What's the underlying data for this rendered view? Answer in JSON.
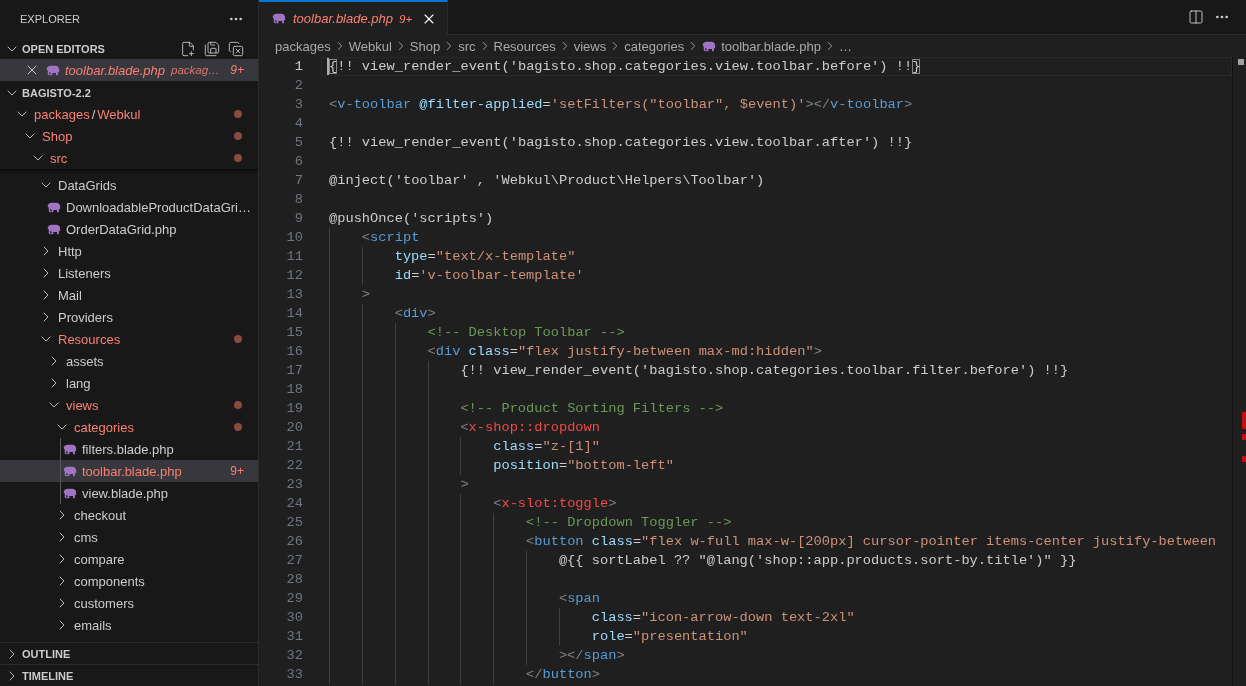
{
  "sidebar": {
    "title": "EXPLORER",
    "open_editors": {
      "title": "OPEN EDITORS",
      "expanded": true,
      "items": [
        {
          "name": "toolbar.blade.php",
          "path": "packag…",
          "badge": "9+",
          "error": true,
          "preview": true,
          "selected": true
        }
      ]
    },
    "project": {
      "title": "BAGISTO-2.2",
      "expanded": true,
      "tree": [
        {
          "kind": "folder",
          "segments": [
            "packages",
            "Webkul"
          ],
          "separator": "/",
          "expanded": true,
          "error": true,
          "selected": false,
          "children": [
            {
              "kind": "folder",
              "name": "Shop",
              "expanded": true,
              "error": true,
              "selected": false,
              "children": [
                {
                  "kind": "folder",
                  "name": "src",
                  "expanded": true,
                  "error": true,
                  "sticky": true,
                  "selected": false,
                  "children": [
                    {
                      "kind": "folder",
                      "name": "DataGrids",
                      "expanded": true,
                      "error": false,
                      "selected": false,
                      "children": [
                        {
                          "kind": "file",
                          "name": "DownloadableProductDataGri…",
                          "error": false,
                          "selected": false
                        },
                        {
                          "kind": "file",
                          "name": "OrderDataGrid.php",
                          "error": false,
                          "selected": false
                        }
                      ]
                    },
                    {
                      "kind": "folder",
                      "name": "Http",
                      "expanded": false,
                      "error": false,
                      "selected": false
                    },
                    {
                      "kind": "folder",
                      "name": "Listeners",
                      "expanded": false,
                      "error": false,
                      "selected": false
                    },
                    {
                      "kind": "folder",
                      "name": "Mail",
                      "expanded": false,
                      "error": false,
                      "selected": false
                    },
                    {
                      "kind": "folder",
                      "name": "Providers",
                      "expanded": false,
                      "error": false,
                      "selected": false
                    },
                    {
                      "kind": "folder",
                      "name": "Resources",
                      "expanded": true,
                      "error": true,
                      "selected": false,
                      "children": [
                        {
                          "kind": "folder",
                          "name": "assets",
                          "expanded": false,
                          "error": false,
                          "selected": false
                        },
                        {
                          "kind": "folder",
                          "name": "lang",
                          "expanded": false,
                          "error": false,
                          "selected": false
                        },
                        {
                          "kind": "folder",
                          "name": "views",
                          "expanded": true,
                          "error": true,
                          "selected": false,
                          "children": [
                            {
                              "kind": "folder",
                              "name": "categories",
                              "expanded": true,
                              "error": true,
                              "selected": false,
                              "children": [
                                {
                                  "kind": "file",
                                  "name": "filters.blade.php",
                                  "error": false,
                                  "selected": false
                                },
                                {
                                  "kind": "file",
                                  "name": "toolbar.blade.php",
                                  "badge": "9+",
                                  "error": true,
                                  "selected": true
                                },
                                {
                                  "kind": "file",
                                  "name": "view.blade.php",
                                  "error": false,
                                  "selected": false
                                }
                              ]
                            },
                            {
                              "kind": "folder",
                              "name": "checkout",
                              "expanded": false,
                              "error": false,
                              "selected": false
                            },
                            {
                              "kind": "folder",
                              "name": "cms",
                              "expanded": false,
                              "error": false,
                              "selected": false
                            },
                            {
                              "kind": "folder",
                              "name": "compare",
                              "expanded": false,
                              "error": false,
                              "selected": false
                            },
                            {
                              "kind": "folder",
                              "name": "components",
                              "expanded": false,
                              "error": false,
                              "selected": false
                            },
                            {
                              "kind": "folder",
                              "name": "customers",
                              "expanded": false,
                              "error": false,
                              "selected": false
                            },
                            {
                              "kind": "folder",
                              "name": "emails",
                              "expanded": false,
                              "error": false,
                              "selected": false
                            }
                          ]
                        }
                      ]
                    }
                  ]
                }
              ]
            }
          ]
        }
      ]
    },
    "sections": [
      {
        "title": "OUTLINE",
        "expanded": false
      },
      {
        "title": "TIMELINE",
        "expanded": false
      }
    ]
  },
  "editor": {
    "tabs": [
      {
        "label": "toolbar.blade.php",
        "badge": "9+",
        "error": true,
        "preview": true,
        "selected": true
      }
    ],
    "breadcrumbs": [
      {
        "kind": "folder",
        "text": "packages"
      },
      {
        "kind": "folder",
        "text": "Webkul"
      },
      {
        "kind": "folder",
        "text": "Shop"
      },
      {
        "kind": "folder",
        "text": "src"
      },
      {
        "kind": "folder",
        "text": "Resources"
      },
      {
        "kind": "folder",
        "text": "views"
      },
      {
        "kind": "folder",
        "text": "categories"
      },
      {
        "kind": "file",
        "text": "toolbar.blade.php"
      },
      {
        "kind": "more",
        "text": "…"
      }
    ],
    "code": {
      "lines": [
        {
          "number": "1",
          "active": true,
          "tokens": [
            {
              "kind": "bracket",
              "text": "{"
            },
            {
              "kind": "plain",
              "text": "!! view_render_event('bagisto.shop.categories.view.toolbar.before') !!"
            },
            {
              "kind": "bracket",
              "text": "}"
            }
          ]
        },
        {
          "number": "2",
          "active": false
        },
        {
          "number": "3",
          "active": false,
          "tokens": [
            {
              "kind": "punct",
              "text": "<"
            },
            {
              "kind": "tag",
              "text": "v-toolbar"
            },
            {
              "kind": "attr",
              "text": " @filter-applied"
            },
            {
              "kind": "plain",
              "text": "="
            },
            {
              "kind": "string",
              "text": "'setFilters(\"toolbar\", $event)'"
            },
            {
              "kind": "punct",
              "text": "></"
            },
            {
              "kind": "tag",
              "text": "v-toolbar"
            },
            {
              "kind": "punct",
              "text": ">"
            }
          ]
        },
        {
          "number": "4",
          "active": false
        },
        {
          "number": "5",
          "active": false,
          "tokens": [
            {
              "kind": "plain",
              "text": "{!! view_render_event('bagisto.shop.categories.view.toolbar.after') !!}"
            }
          ]
        },
        {
          "number": "6",
          "active": false
        },
        {
          "number": "7",
          "active": false,
          "tokens": [
            {
              "kind": "plain",
              "text": "@inject('toolbar' , 'Webkul\\Product\\Helpers\\Toolbar')"
            }
          ]
        },
        {
          "number": "8",
          "active": false
        },
        {
          "number": "9",
          "active": false,
          "tokens": [
            {
              "kind": "plain",
              "text": "@pushOnce('scripts')"
            }
          ],
          "children": [
            {
              "number": "10",
              "active": false,
              "tokens": [
                {
                  "kind": "punct",
                  "text": "<"
                },
                {
                  "kind": "tag",
                  "text": "script"
                }
              ],
              "children": [
                {
                  "number": "11",
                  "active": false,
                  "tokens": [
                    {
                      "kind": "attr",
                      "text": "type"
                    },
                    {
                      "kind": "plain",
                      "text": "="
                    },
                    {
                      "kind": "string",
                      "text": "\"text/x-template\""
                    }
                  ]
                },
                {
                  "number": "12",
                  "active": false,
                  "tokens": [
                    {
                      "kind": "attr",
                      "text": "id"
                    },
                    {
                      "kind": "plain",
                      "text": "="
                    },
                    {
                      "kind": "string",
                      "text": "'v-toolbar-template'"
                    }
                  ]
                }
              ]
            },
            {
              "number": "13",
              "active": false,
              "tokens": [
                {
                  "kind": "punct",
                  "text": ">"
                }
              ],
              "children": [
                {
                  "number": "14",
                  "active": false,
                  "tokens": [
                    {
                      "kind": "punct",
                      "text": "<"
                    },
                    {
                      "kind": "tag",
                      "text": "div"
                    },
                    {
                      "kind": "punct",
                      "text": ">"
                    }
                  ],
                  "children": [
                    {
                      "number": "15",
                      "active": false,
                      "tokens": [
                        {
                          "kind": "comment",
                          "text": "<!-- Desktop Toolbar -->"
                        }
                      ]
                    },
                    {
                      "number": "16",
                      "active": false,
                      "tokens": [
                        {
                          "kind": "punct",
                          "text": "<"
                        },
                        {
                          "kind": "tag",
                          "text": "div"
                        },
                        {
                          "kind": "attr",
                          "text": " class"
                        },
                        {
                          "kind": "plain",
                          "text": "="
                        },
                        {
                          "kind": "string",
                          "text": "\"flex justify-between max-md:hidden\""
                        },
                        {
                          "kind": "punct",
                          "text": ">"
                        }
                      ],
                      "children": [
                        {
                          "number": "17",
                          "active": false,
                          "tokens": [
                            {
                              "kind": "plain",
                              "text": "{!! view_render_event('bagisto.shop.categories.toolbar.filter.before') !!}"
                            }
                          ]
                        },
                        {
                          "number": "18",
                          "active": false
                        },
                        {
                          "number": "19",
                          "active": false,
                          "tokens": [
                            {
                              "kind": "comment",
                              "text": "<!-- Product Sorting Filters -->"
                            }
                          ]
                        },
                        {
                          "number": "20",
                          "active": false,
                          "tokens": [
                            {
                              "kind": "punct",
                              "text": "<"
                            },
                            {
                              "kind": "component",
                              "text": "x-shop::dropdown"
                            }
                          ],
                          "children": [
                            {
                              "number": "21",
                              "active": false,
                              "tokens": [
                                {
                                  "kind": "attr",
                                  "text": "class"
                                },
                                {
                                  "kind": "plain",
                                  "text": "="
                                },
                                {
                                  "kind": "string",
                                  "text": "\"z-[1]\""
                                }
                              ]
                            },
                            {
                              "number": "22",
                              "active": false,
                              "tokens": [
                                {
                                  "kind": "attr",
                                  "text": "position"
                                },
                                {
                                  "kind": "plain",
                                  "text": "="
                                },
                                {
                                  "kind": "string",
                                  "text": "\"bottom-left\""
                                }
                              ]
                            }
                          ]
                        },
                        {
                          "number": "23",
                          "active": false,
                          "tokens": [
                            {
                              "kind": "punct",
                              "text": ">"
                            }
                          ],
                          "children": [
                            {
                              "number": "24",
                              "active": false,
                              "tokens": [
                                {
                                  "kind": "punct",
                                  "text": "<"
                                },
                                {
                                  "kind": "component",
                                  "text": "x-slot:toggle"
                                },
                                {
                                  "kind": "punct",
                                  "text": ">"
                                }
                              ],
                              "children": [
                                {
                                  "number": "25",
                                  "active": false,
                                  "tokens": [
                                    {
                                      "kind": "comment",
                                      "text": "<!-- Dropdown Toggler -->"
                                    }
                                  ]
                                },
                                {
                                  "number": "26",
                                  "active": false,
                                  "tokens": [
                                    {
                                      "kind": "punct",
                                      "text": "<"
                                    },
                                    {
                                      "kind": "tag",
                                      "text": "button"
                                    },
                                    {
                                      "kind": "attr",
                                      "text": " class"
                                    },
                                    {
                                      "kind": "plain",
                                      "text": "="
                                    },
                                    {
                                      "kind": "string",
                                      "text": "\"flex w-full max-w-[200px] cursor-pointer items-center justify-between"
                                    }
                                  ],
                                  "children": [
                                    {
                                      "number": "27",
                                      "active": false,
                                      "tokens": [
                                        {
                                          "kind": "plain",
                                          "text": "@{{ sortLabel ?? \"@lang('shop::app.products.sort-by.title')\" }}"
                                        }
                                      ]
                                    },
                                    {
                                      "number": "28",
                                      "active": false
                                    },
                                    {
                                      "number": "29",
                                      "active": false,
                                      "tokens": [
                                        {
                                          "kind": "punct",
                                          "text": "<"
                                        },
                                        {
                                          "kind": "tag",
                                          "text": "span"
                                        }
                                      ],
                                      "children": [
                                        {
                                          "number": "30",
                                          "active": false,
                                          "tokens": [
                                            {
                                              "kind": "attr",
                                              "text": "class"
                                            },
                                            {
                                              "kind": "plain",
                                              "text": "="
                                            },
                                            {
                                              "kind": "string",
                                              "text": "\"icon-arrow-down text-2xl\""
                                            }
                                          ]
                                        },
                                        {
                                          "number": "31",
                                          "active": false,
                                          "tokens": [
                                            {
                                              "kind": "attr",
                                              "text": "role"
                                            },
                                            {
                                              "kind": "plain",
                                              "text": "="
                                            },
                                            {
                                              "kind": "string",
                                              "text": "\"presentation\""
                                            }
                                          ]
                                        }
                                      ]
                                    },
                                    {
                                      "number": "32",
                                      "active": false,
                                      "tokens": [
                                        {
                                          "kind": "punct",
                                          "text": "></"
                                        },
                                        {
                                          "kind": "tag",
                                          "text": "span"
                                        },
                                        {
                                          "kind": "punct",
                                          "text": ">"
                                        }
                                      ]
                                    }
                                  ]
                                },
                                {
                                  "number": "33",
                                  "active": false,
                                  "tokens": [
                                    {
                                      "kind": "punct",
                                      "text": "</"
                                    },
                                    {
                                      "kind": "tag",
                                      "text": "button"
                                    },
                                    {
                                      "kind": "punct",
                                      "text": ">"
                                    }
                                  ]
                                }
                              ]
                            }
                          ]
                        }
                      ]
                    }
                  ]
                }
              ]
            }
          ]
        }
      ]
    }
  }
}
